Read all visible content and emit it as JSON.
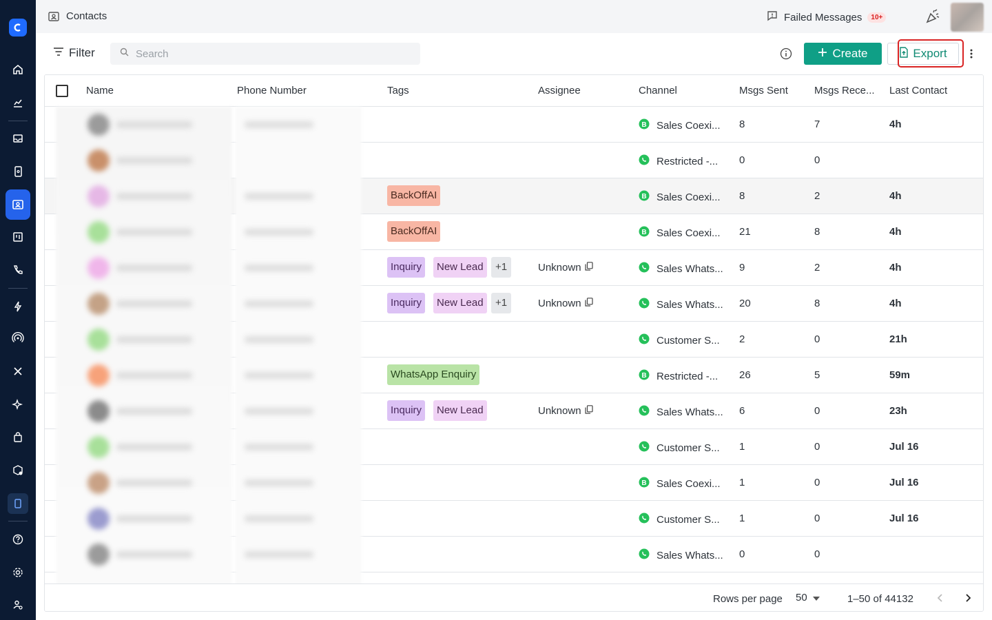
{
  "topbar": {
    "title": "Contacts",
    "failed_label": "Failed Messages",
    "failed_badge": "10+"
  },
  "toolbar": {
    "filter_label": "Filter",
    "search_placeholder": "Search",
    "create_label": "Create",
    "export_label": "Export"
  },
  "table": {
    "headers": {
      "name": "Name",
      "phone": "Phone Number",
      "tags": "Tags",
      "assignee": "Assignee",
      "channel": "Channel",
      "sent": "Msgs Sent",
      "received": "Msgs Rece...",
      "last": "Last Contact"
    },
    "rows": [
      {
        "channel": "Sales Coexi...",
        "channel_type": "business",
        "sent": "8",
        "received": "7",
        "last": "4h"
      },
      {
        "channel": "Restricted -...",
        "channel_type": "whatsapp",
        "sent": "0",
        "received": "0",
        "last": ""
      },
      {
        "channel": "Sales Coexi...",
        "channel_type": "business",
        "sent": "8",
        "received": "2",
        "last": "4h",
        "tag1": "BackOffAI"
      },
      {
        "channel": "Sales Coexi...",
        "channel_type": "business",
        "sent": "21",
        "received": "8",
        "last": "4h",
        "tag1": "BackOffAI"
      },
      {
        "channel": "Sales Whats...",
        "channel_type": "whatsapp",
        "sent": "9",
        "received": "2",
        "last": "4h",
        "tag1": "Inquiry",
        "tag2": "New Lead",
        "tag3": "+1",
        "assignee": "Unknown"
      },
      {
        "channel": "Sales Whats...",
        "channel_type": "whatsapp",
        "sent": "20",
        "received": "8",
        "last": "4h",
        "tag1": "Inquiry",
        "tag2": "New Lead",
        "tag3": "+1",
        "assignee": "Unknown"
      },
      {
        "channel": "Customer S...",
        "channel_type": "whatsapp",
        "sent": "2",
        "received": "0",
        "last": "21h"
      },
      {
        "channel": "Restricted -...",
        "channel_type": "business",
        "sent": "26",
        "received": "5",
        "last": "59m",
        "tag1": "WhatsApp Enquiry"
      },
      {
        "channel": "Sales Whats...",
        "channel_type": "whatsapp",
        "sent": "6",
        "received": "0",
        "last": "23h",
        "tag1": "Inquiry",
        "tag2": "New Lead",
        "assignee": "Unknown"
      },
      {
        "channel": "Customer S...",
        "channel_type": "whatsapp",
        "sent": "1",
        "received": "0",
        "last": "Jul 16"
      },
      {
        "channel": "Sales Coexi...",
        "channel_type": "business",
        "sent": "1",
        "received": "0",
        "last": "Jul 16"
      },
      {
        "channel": "Customer S...",
        "channel_type": "whatsapp",
        "sent": "1",
        "received": "0",
        "last": "Jul 16"
      },
      {
        "channel": "Sales Whats...",
        "channel_type": "whatsapp",
        "sent": "0",
        "received": "0",
        "last": ""
      }
    ]
  },
  "footer": {
    "rows_per_page_label": "Rows per page",
    "rows_per_page_value": "50",
    "range": "1–50 of 44132"
  },
  "colors": {
    "sidebar_bg": "#0c1b33",
    "accent_green": "#0f9f86",
    "active_nav": "#2563eb",
    "highlight_red": "#d92323"
  }
}
